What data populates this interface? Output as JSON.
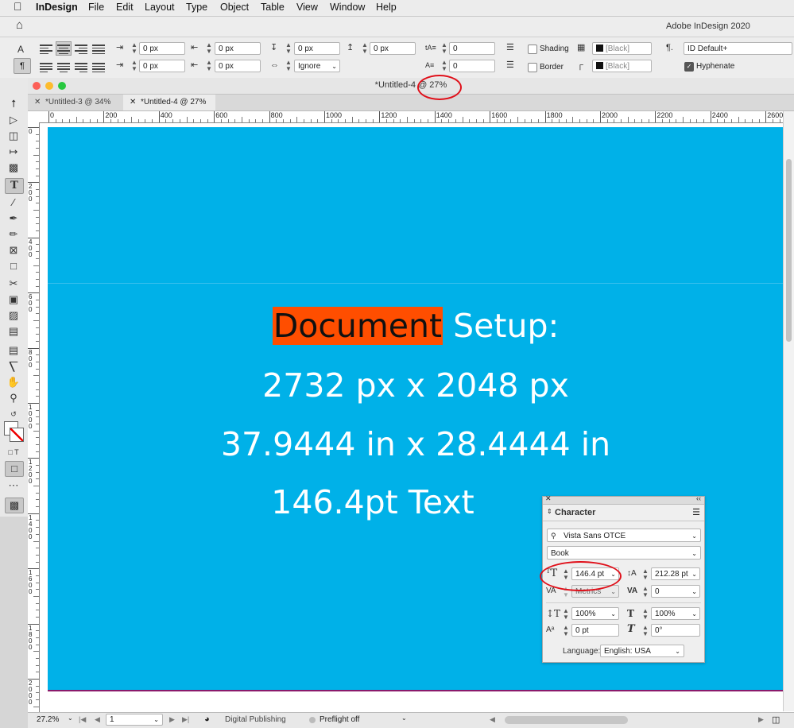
{
  "menubar": {
    "app_name": "InDesign",
    "items": [
      "File",
      "Edit",
      "Layout",
      "Type",
      "Object",
      "Table",
      "View",
      "Window",
      "Help"
    ]
  },
  "app_window_title": "Adobe InDesign 2020",
  "control_panel": {
    "indent_left": "0 px",
    "indent_right": "0 px",
    "first_line_indent": "0 px",
    "last_line_indent": "0 px",
    "space_before": "0 px",
    "space_after": "0 px",
    "drop_cap_lines": "0",
    "drop_cap_chars": "0",
    "align_to_grid": "Ignore",
    "shading_label": "Shading",
    "border_label": "Border",
    "shading_color": "[Black]",
    "border_color": "[Black]",
    "paragraph_style": "ID Default+",
    "hyphenate_label": "Hyphenate"
  },
  "document": {
    "title": "*Untitled-4 @ 27%",
    "tabs": [
      {
        "label": "*Untitled-3 @ 34%",
        "active": false
      },
      {
        "label": "*Untitled-4 @ 27%",
        "active": true
      }
    ],
    "ruler_h": [
      "0",
      "200",
      "400",
      "600",
      "800",
      "1000",
      "1200",
      "1400",
      "1600",
      "1800",
      "2000",
      "2200",
      "2400",
      "2600"
    ],
    "ruler_v": [
      "0",
      "200",
      "400",
      "600",
      "800",
      "1000",
      "1200",
      "1400",
      "1600",
      "1800",
      "2000"
    ],
    "text_lines": {
      "line1_highlight": "Document",
      "line1_rest": " Setup:",
      "line2": "2732 px x 2048 px",
      "line3": "37.9444 in x 28.4444 in",
      "line4": "146.4pt Text"
    },
    "page_color": "#00b1e8",
    "highlight_color": "#ff4e00"
  },
  "character_panel": {
    "title": "Character",
    "font_family": "Vista Sans OTCE",
    "font_style": "Book",
    "font_size": "146.4 pt",
    "leading": "212.28 pt",
    "kerning": "Metrics",
    "tracking": "0",
    "vertical_scale": "100%",
    "horizontal_scale": "100%",
    "baseline_shift": "0 pt",
    "skew": "0°",
    "language_label": "Language:",
    "language": "English: USA"
  },
  "statusbar": {
    "zoom": "27.2%",
    "page": "1",
    "workspace": "Digital Publishing",
    "preflight": "Preflight off"
  },
  "annotation_color": "#e0101a"
}
